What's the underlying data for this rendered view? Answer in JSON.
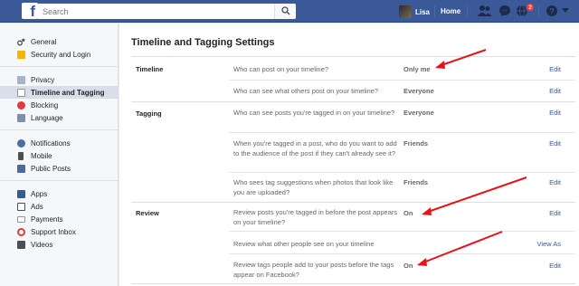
{
  "header": {
    "logo_letter": "f",
    "search_placeholder": "Search",
    "user_name": "Lisa",
    "home_label": "Home",
    "notification_count": "2",
    "brand_color": "#3b5998"
  },
  "sidebar": {
    "groups": [
      [
        {
          "label": "General",
          "icon": "gear-icon"
        },
        {
          "label": "Security and Login",
          "icon": "shield-icon"
        }
      ],
      [
        {
          "label": "Privacy",
          "icon": "lock-icon"
        },
        {
          "label": "Timeline and Tagging",
          "icon": "timeline-icon"
        },
        {
          "label": "Blocking",
          "icon": "blocking-icon"
        },
        {
          "label": "Language",
          "icon": "language-icon"
        }
      ],
      [
        {
          "label": "Notifications",
          "icon": "globe-icon"
        },
        {
          "label": "Mobile",
          "icon": "mobile-icon"
        },
        {
          "label": "Public Posts",
          "icon": "rss-icon"
        }
      ],
      [
        {
          "label": "Apps",
          "icon": "apps-icon"
        },
        {
          "label": "Ads",
          "icon": "ads-icon"
        },
        {
          "label": "Payments",
          "icon": "payments-icon"
        },
        {
          "label": "Support Inbox",
          "icon": "lifebuoy-icon"
        },
        {
          "label": "Videos",
          "icon": "video-icon"
        }
      ]
    ]
  },
  "main": {
    "title": "Timeline and Tagging Settings",
    "sections": [
      {
        "label": "Timeline",
        "rows": [
          {
            "question": "Who can post on your timeline?",
            "value": "Only me",
            "action": "Edit"
          },
          {
            "question": "Who can see what others post on your timeline?",
            "value": "Everyone",
            "action": "Edit"
          }
        ]
      },
      {
        "label": "Tagging",
        "rows": [
          {
            "question": "Who can see posts you're tagged in on your timeline?",
            "value": "Everyone",
            "action": "Edit"
          },
          {
            "question": "When you're tagged in a post, who do you want to add to the audience of the post if they can't already see it?",
            "value": "Friends",
            "action": "Edit"
          },
          {
            "question": "Who sees tag suggestions when photos that look like you are uploaded?",
            "value": "Friends",
            "action": "Edit"
          }
        ]
      },
      {
        "label": "Review",
        "rows": [
          {
            "question": "Review posts you're tagged in before the post appears on your timeline?",
            "value": "On",
            "action": "Edit"
          },
          {
            "question": "Review what other people see on your timeline",
            "value": "",
            "action": "View As"
          },
          {
            "question": "Review tags people add to your posts before the tags appear on Facebook?",
            "value": "On",
            "action": "Edit"
          }
        ]
      }
    ]
  },
  "annotation": {
    "arrow_color": "#e8121b"
  }
}
